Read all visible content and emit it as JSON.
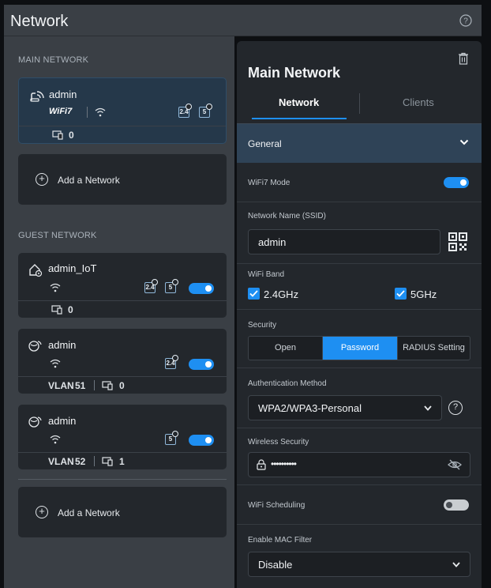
{
  "header": {
    "title": "Network"
  },
  "left": {
    "main_section_label": "MAIN NETWORK",
    "guest_section_label": "GUEST NETWORK",
    "main_network": {
      "name": "admin",
      "wifi_badge": "WiFi7",
      "bands": [
        "2.4",
        "5"
      ],
      "client_count": "0"
    },
    "add_network_label": "Add a Network",
    "guest_networks": [
      {
        "name": "admin_IoT",
        "bands": [
          "2.4",
          "5"
        ],
        "enabled": true,
        "vlan_label": "",
        "vlan": "",
        "client_count": "0"
      },
      {
        "name": "admin",
        "bands": [
          "2.4"
        ],
        "enabled": true,
        "vlan_label": "VLAN",
        "vlan": "51",
        "client_count": "0"
      },
      {
        "name": "admin",
        "bands": [
          "5"
        ],
        "enabled": true,
        "vlan_label": "VLAN",
        "vlan": "52",
        "client_count": "1"
      }
    ]
  },
  "panel": {
    "title": "Main Network",
    "tabs": {
      "network": "Network",
      "clients": "Clients"
    },
    "general": "General",
    "wifi7_mode": {
      "label": "WiFi7 Mode",
      "enabled": true
    },
    "ssid": {
      "label": "Network Name (SSID)",
      "value": "admin"
    },
    "wifi_band": {
      "label": "WiFi Band",
      "band1": "2.4GHz",
      "band2": "5GHz"
    },
    "security": {
      "label": "Security",
      "options": [
        "Open",
        "Password",
        "RADIUS Setting"
      ],
      "selected": "Password"
    },
    "auth": {
      "label": "Authentication Method",
      "value": "WPA2/WPA3-Personal"
    },
    "wireless_security": {
      "label": "Wireless Security",
      "value": "••••••••••"
    },
    "wifi_scheduling": {
      "label": "WiFi Scheduling",
      "enabled": false
    },
    "mac_filter": {
      "label": "Enable MAC Filter",
      "value": "Disable"
    }
  },
  "colors": {
    "accent": "#1e8ff2",
    "panel_bg": "#23272c",
    "sidebar_bg": "#3a3f45",
    "selected_card": "#25384a"
  }
}
